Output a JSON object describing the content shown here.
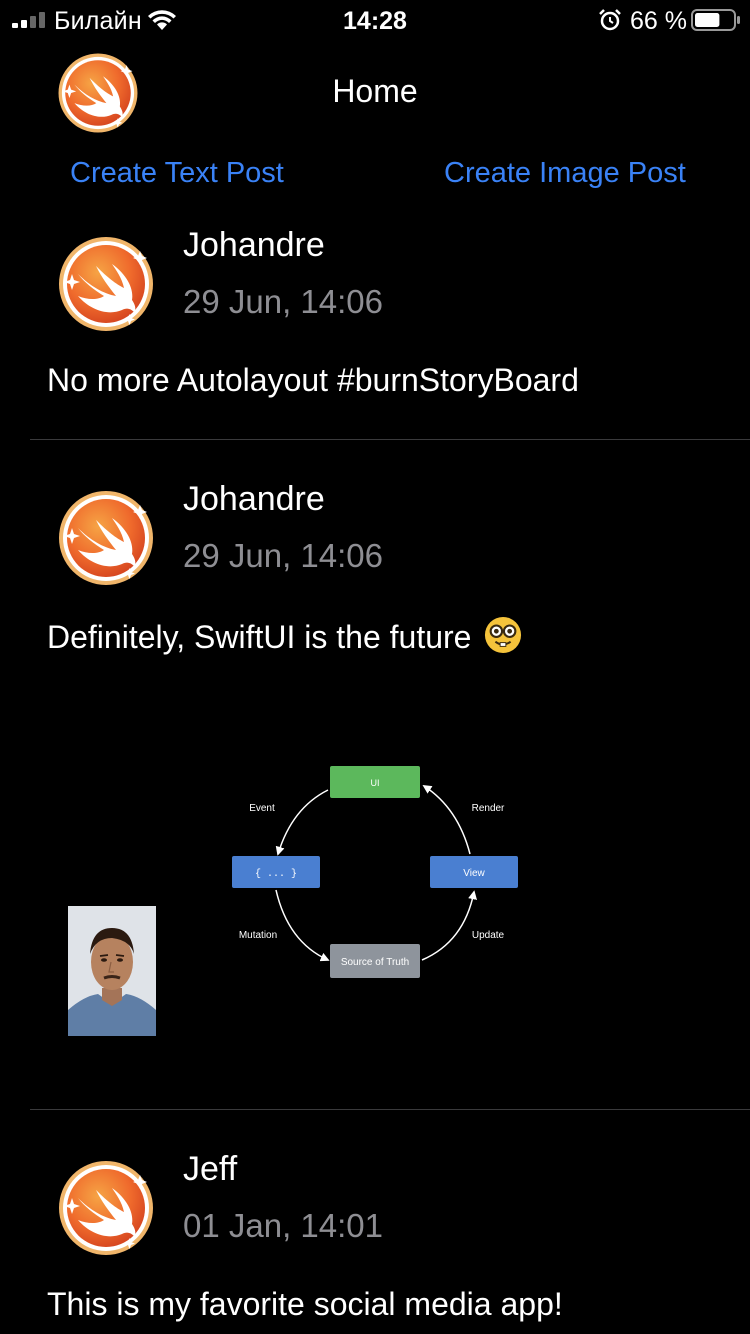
{
  "status_bar": {
    "carrier": "Билайн",
    "time": "14:28",
    "battery_percent": "66 %",
    "battery_level": 0.66,
    "icons": [
      "signal-icon",
      "wifi-icon",
      "alarm-icon",
      "battery-icon"
    ]
  },
  "header": {
    "title": "Home",
    "logo": "swift-logo-icon",
    "create_text_post": "Create Text Post",
    "create_image_post": "Create Image Post"
  },
  "posts": [
    {
      "author": "Johandre",
      "time": "29 Jun, 14:06",
      "text": "No more Autolayout #burnStoryBoard"
    },
    {
      "author": "Johandre",
      "time": "29 Jun, 14:06",
      "text": "Definitely, SwiftUI is the future",
      "emoji": "nerd-face-icon",
      "image": {
        "diagram": {
          "nodes": {
            "ui": "UI",
            "view": "View",
            "source": "Source of Truth",
            "action": "{ ... }"
          },
          "edges": {
            "event": "Event",
            "render": "Render",
            "mutation": "Mutation",
            "update": "Update"
          }
        }
      }
    },
    {
      "author": "Jeff",
      "time": "01 Jan, 14:01",
      "text": "This is my favorite social media app!"
    }
  ],
  "colors": {
    "background": "#000000",
    "link": "#3a82f6",
    "secondary_text": "#8e8e93",
    "diagram_ui": "#5cb85c",
    "diagram_view": "#4a7fd1",
    "diagram_source": "#8e949c"
  }
}
